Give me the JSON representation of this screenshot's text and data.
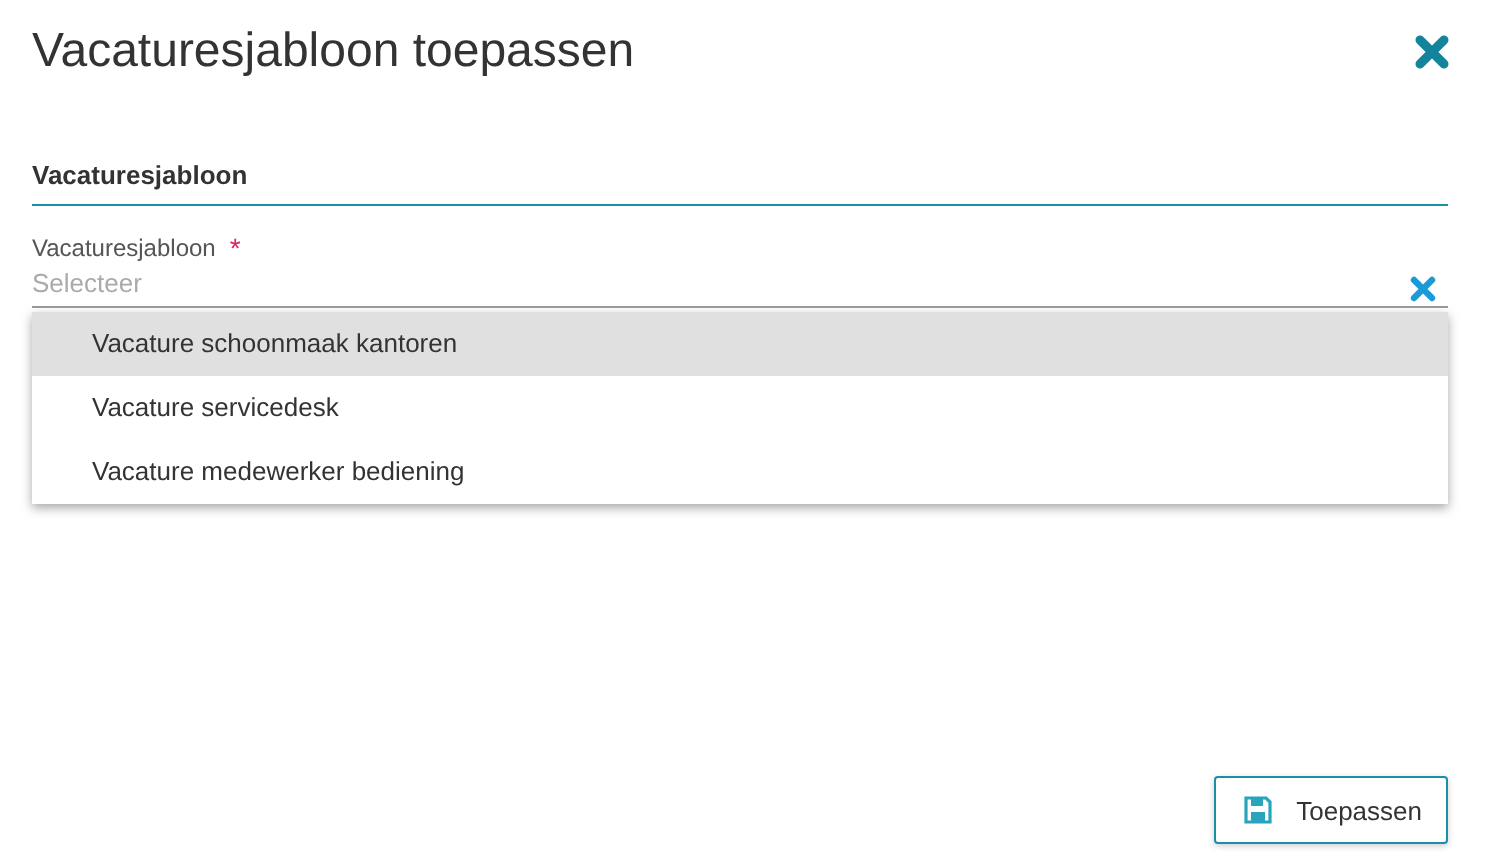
{
  "dialog": {
    "title": "Vacaturesjabloon toepassen"
  },
  "section": {
    "heading": "Vacaturesjabloon"
  },
  "field": {
    "label": "Vacaturesjabloon",
    "required_mark": "*",
    "placeholder": "Selecteer"
  },
  "options": [
    {
      "label": "Vacature schoonmaak kantoren",
      "selected": true
    },
    {
      "label": "Vacature servicedesk",
      "selected": false
    },
    {
      "label": "Vacature medewerker bediening",
      "selected": false
    }
  ],
  "buttons": [
    {
      "label": "Toepassen"
    }
  ]
}
